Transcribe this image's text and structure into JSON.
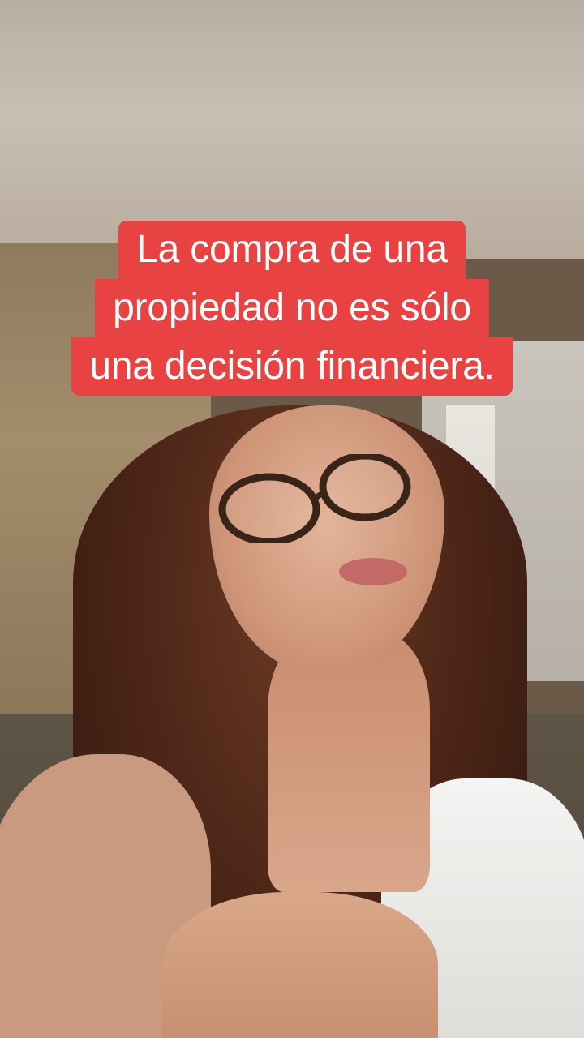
{
  "caption": {
    "lines": [
      "La compra de una",
      "propiedad no es sólo",
      "una decisión financiera."
    ],
    "background_color": "#e84242",
    "text_color": "#ffffff"
  }
}
